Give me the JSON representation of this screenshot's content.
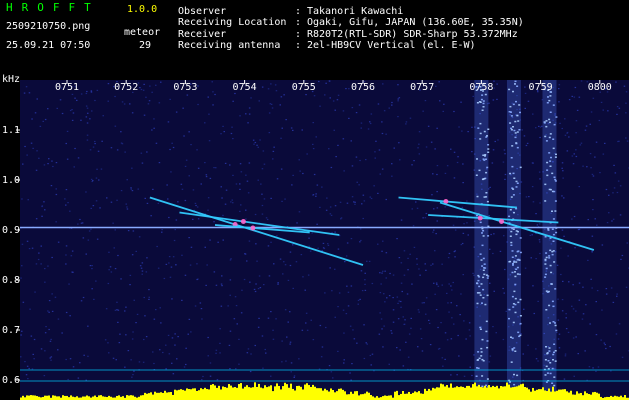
{
  "app": {
    "name": "HROFFT",
    "version": "1.0.0",
    "filename": "2509210750.png",
    "datetime": "25.09.21 07:50",
    "meteor_label": "meteor",
    "meteor_count": "29"
  },
  "info": [
    {
      "label": "Observer",
      "sep": ":",
      "value": "Takanori Kawachi"
    },
    {
      "label": "Receiving Location",
      "sep": ":",
      "value": "Ogaki, Gifu, JAPAN (136.60E, 35.35N)"
    },
    {
      "label": "Receiver",
      "sep": ":",
      "value": "R820T2(RTL-SDR) SDR-Sharp 53.372MHz"
    },
    {
      "label": "Receiving antenna",
      "sep": ":",
      "value": "2el-HB9CV Vertical (el. E-W)"
    }
  ],
  "colors": {
    "background": "#000000",
    "plot_bg": "#0a0a3a",
    "carrier": "#88aaff",
    "meteor_trail": "#33ccff",
    "meteor_head": "#ff66cc",
    "histogram": "#ffff00",
    "baseline": "#00ccff",
    "text_green": "#00ff00",
    "text_yellow": "#ffff00",
    "text_white": "#ffffff"
  },
  "chart_data": {
    "type": "heatmap",
    "ylabel": "kHz",
    "x_ticks": [
      "0751",
      "0752",
      "0753",
      "0754",
      "0755",
      "0756",
      "0757",
      "0758",
      "0759",
      "0800"
    ],
    "y_ticks": [
      "1.1",
      "1.0",
      "0.9",
      "0.8",
      "0.7",
      "0.6"
    ],
    "ylim": [
      0.58,
      1.18
    ],
    "carrier_freq_khz": 0.905,
    "interference_columns": [
      "0758",
      "0758.5",
      "0759"
    ],
    "meteor_traces": [
      {
        "start": [
          1.4,
          0.965
        ],
        "end": [
          5.0,
          0.83
        ]
      },
      {
        "start": [
          1.9,
          0.935
        ],
        "end": [
          4.6,
          0.89
        ]
      },
      {
        "start": [
          2.5,
          0.91
        ],
        "end": [
          4.1,
          0.895
        ]
      },
      {
        "start": [
          5.6,
          0.965
        ],
        "end": [
          7.6,
          0.945
        ]
      },
      {
        "start": [
          6.1,
          0.93
        ],
        "end": [
          8.3,
          0.915
        ]
      },
      {
        "start": [
          6.3,
          0.955
        ],
        "end": [
          8.9,
          0.86
        ]
      }
    ]
  }
}
